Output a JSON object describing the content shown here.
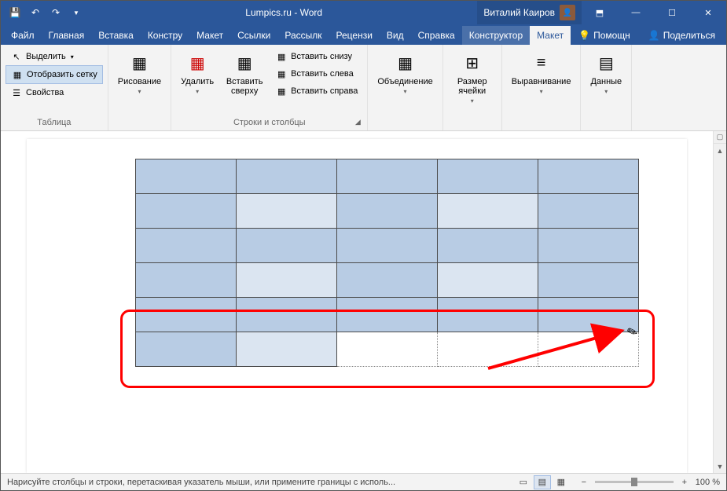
{
  "titlebar": {
    "title": "Lumpics.ru - Word",
    "user_name": "Виталий Каиров"
  },
  "tabs": {
    "file": "Файл",
    "home": "Главная",
    "insert": "Вставка",
    "design": "Констру",
    "layout": "Макет",
    "references": "Ссылки",
    "mailings": "Рассылк",
    "review": "Рецензи",
    "view": "Вид",
    "help": "Справка",
    "table_design": "Конструктор",
    "table_layout": "Макет",
    "tell_me": "Помощн",
    "share": "Поделиться"
  },
  "ribbon": {
    "table_group": {
      "select": "Выделить",
      "gridlines": "Отобразить сетку",
      "properties": "Свойства",
      "label": "Таблица"
    },
    "draw_group": {
      "draw": "Рисование",
      "label": ""
    },
    "rowscols_group": {
      "delete": "Удалить",
      "insert_above": "Вставить сверху",
      "insert_below": "Вставить снизу",
      "insert_left": "Вставить слева",
      "insert_right": "Вставить справа",
      "label": "Строки и столбцы"
    },
    "merge_group": {
      "merge": "Объединение",
      "label": ""
    },
    "cellsize_group": {
      "size": "Размер ячейки",
      "label": ""
    },
    "align_group": {
      "align": "Выравнивание",
      "label": ""
    },
    "data_group": {
      "data": "Данные",
      "label": ""
    }
  },
  "statusbar": {
    "message": "Нарисуйте столбцы и строки, перетаскивая указатель мыши, или примените границы с исполь...",
    "zoom": "100 %"
  }
}
